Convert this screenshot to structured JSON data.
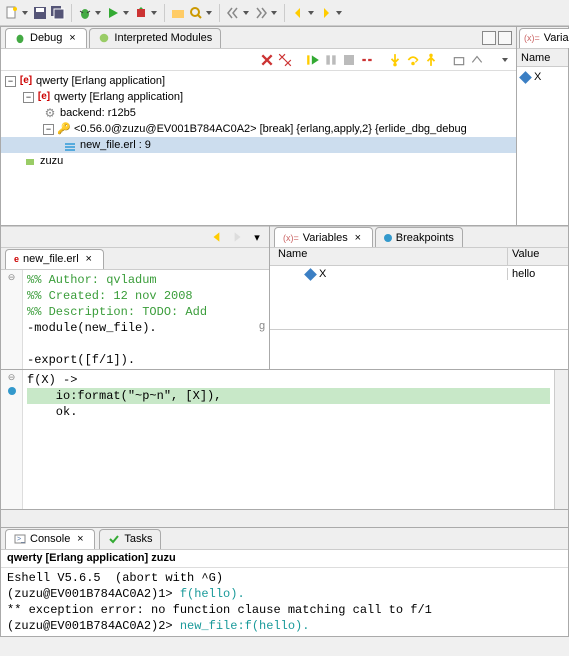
{
  "toolbar": {
    "items": [
      "new",
      "save",
      "save-all",
      "bug",
      "run",
      "ext"
    ]
  },
  "debug_view": {
    "tab_label": "Debug",
    "tab2_label": "Interpreted Modules",
    "tree": {
      "app1": "qwerty [Erlang application]",
      "app2": "qwerty [Erlang application]",
      "backend": "backend: r12b5",
      "process": "<0.56.0@zuzu@EV001B784AC0A2> [break] {erlang,apply,2} {erlide_dbg_debug",
      "file": "new_file.erl : 9",
      "node": "zuzu"
    }
  },
  "vars_right": {
    "tab_label": "Variabl",
    "header": "Name",
    "var1": "X"
  },
  "editor_tab": {
    "filename": "new_file.erl"
  },
  "code": {
    "l1": "%% Author: qvladum",
    "l2": "%% Created: 12 nov 2008",
    "l3": "%% Description: TODO: Add",
    "l4": "-module(new_file).",
    "l5": "",
    "l6": "-export([f/1]).",
    "suffix": "g"
  },
  "code2": {
    "l1": "f(X) ->",
    "l2": "    io:format(\"~p~n\", [X]),",
    "l3": "    ok."
  },
  "vars_panel": {
    "tab1": "Variables",
    "tab2": "Breakpoints",
    "col1": "Name",
    "col2": "Value",
    "row1_name": "X",
    "row1_value": "hello"
  },
  "console": {
    "tab1": "Console",
    "tab2": "Tasks",
    "title": "qwerty [Erlang application] zuzu",
    "l1": "Eshell V5.6.5  (abort with ^G)",
    "l2_prompt": "(zuzu@EV001B784AC0A2)1> ",
    "l2_call": "f(hello).",
    "l3": "** exception error: no function clause matching call to f/1",
    "l4_prompt": "(zuzu@EV001B784AC0A2)2> ",
    "l4_call": "new_file:f(hello)."
  }
}
